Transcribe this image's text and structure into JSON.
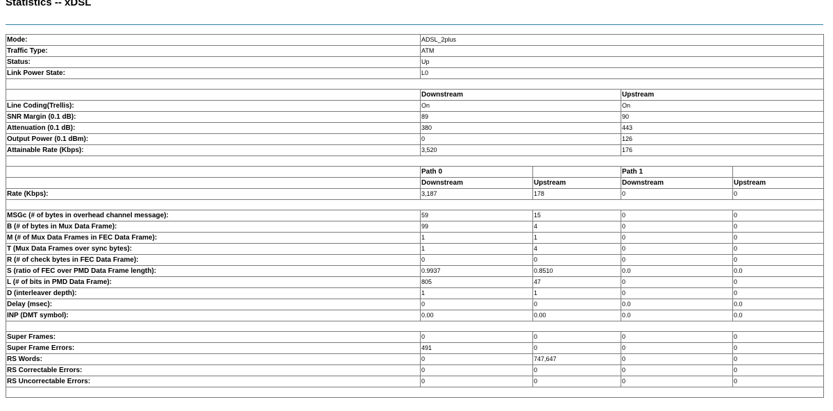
{
  "page": {
    "title": "Statistics -- xDSL"
  },
  "general": [
    {
      "label": "Mode:",
      "value": "ADSL_2plus"
    },
    {
      "label": "Traffic Type:",
      "value": "ATM"
    },
    {
      "label": "Status:",
      "value": "Up"
    },
    {
      "label": "Link Power State:",
      "value": "L0"
    }
  ],
  "line": {
    "headers": [
      "Downstream",
      "Upstream"
    ],
    "rows": [
      {
        "label": "Line Coding(Trellis):",
        "down": "On",
        "up": "On"
      },
      {
        "label": "SNR Margin (0.1 dB):",
        "down": "89",
        "up": "90"
      },
      {
        "label": "Attenuation (0.1 dB):",
        "down": "380",
        "up": "443"
      },
      {
        "label": "Output Power (0.1 dBm):",
        "down": "0",
        "up": "126"
      },
      {
        "label": "Attainable Rate (Kbps):",
        "down": "3,520",
        "up": "176"
      }
    ]
  },
  "paths": {
    "path_headers": [
      "Path 0",
      "Path 1"
    ],
    "dir_headers": [
      "Downstream",
      "Upstream",
      "Downstream",
      "Upstream"
    ],
    "rate": {
      "label": "Rate (Kbps):",
      "values": [
        "3,187",
        "178",
        "0",
        "0"
      ]
    },
    "params": [
      {
        "label": "MSGc (# of bytes in overhead channel message):",
        "values": [
          "59",
          "15",
          "0",
          "0"
        ]
      },
      {
        "label": "B (# of bytes in Mux Data Frame):",
        "values": [
          "99",
          "4",
          "0",
          "0"
        ]
      },
      {
        "label": "M (# of Mux Data Frames in FEC Data Frame):",
        "values": [
          "1",
          "1",
          "0",
          "0"
        ]
      },
      {
        "label": "T (Mux Data Frames over sync bytes):",
        "values": [
          "1",
          "4",
          "0",
          "0"
        ]
      },
      {
        "label": "R (# of check bytes in FEC Data Frame):",
        "values": [
          "0",
          "0",
          "0",
          "0"
        ]
      },
      {
        "label": "S (ratio of FEC over PMD Data Frame length):",
        "values": [
          "0.9937",
          "0.8510",
          "0.0",
          "0.0"
        ]
      },
      {
        "label": "L (# of bits in PMD Data Frame):",
        "values": [
          "805",
          "47",
          "0",
          "0"
        ]
      },
      {
        "label": "D (interleaver depth):",
        "values": [
          "1",
          "1",
          "0",
          "0"
        ]
      },
      {
        "label": "Delay (msec):",
        "values": [
          "0",
          "0",
          "0.0",
          "0.0"
        ]
      },
      {
        "label": "INP (DMT symbol):",
        "values": [
          "0.00",
          "0.00",
          "0.0",
          "0.0"
        ]
      }
    ],
    "counters": [
      {
        "label": "Super Frames:",
        "values": [
          "0",
          "0",
          "0",
          "0"
        ]
      },
      {
        "label": "Super Frame Errors:",
        "values": [
          "491",
          "0",
          "0",
          "0"
        ]
      },
      {
        "label": "RS Words:",
        "values": [
          "0",
          "747,647",
          "0",
          "0"
        ]
      },
      {
        "label": "RS Correctable Errors:",
        "values": [
          "0",
          "0",
          "0",
          "0"
        ]
      },
      {
        "label": "RS Uncorrectable Errors:",
        "values": [
          "0",
          "0",
          "0",
          "0"
        ]
      }
    ]
  }
}
